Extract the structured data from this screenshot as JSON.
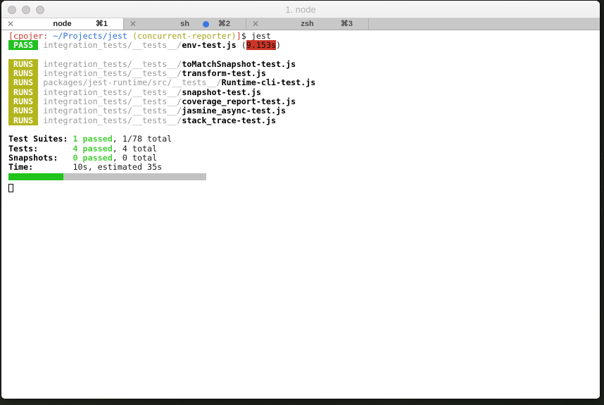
{
  "window": {
    "title": "1. node"
  },
  "colors": {
    "pass_badge": "#20c120",
    "runs_badge": "#b2b51c",
    "time_highlight": "#cc3527",
    "prompt_red": "#c5382a",
    "path_blue": "#2e6fd9",
    "branch_yellow": "#a3a31c",
    "passed_green": "#47d038",
    "progress_green": "#1ec31c",
    "tab_activity_blue": "#3b76e3"
  },
  "tabs": [
    {
      "label": "node",
      "shortcut": "⌘1",
      "close": "✕",
      "active": true,
      "activity": false
    },
    {
      "label": "sh",
      "shortcut": "⌘2",
      "close": "✕",
      "active": false,
      "activity": true
    },
    {
      "label": "zsh",
      "shortcut": "⌘3",
      "close": "✕",
      "active": false,
      "activity": false
    }
  ],
  "terminal": {
    "progress_percent": 27.8,
    "lines": [
      {
        "segments": [
          {
            "t": "[cpojer:",
            "c": "red"
          },
          {
            "t": " ",
            "c": "fg"
          },
          {
            "t": "~/Projects/jest",
            "c": "blue"
          },
          {
            "t": " ",
            "c": "fg"
          },
          {
            "t": "(concurrent-reporter)",
            "c": "yellow"
          },
          {
            "t": "]",
            "c": "red"
          },
          {
            "t": "$ jest",
            "c": "fg"
          }
        ]
      },
      {
        "segments": [
          {
            "t": " PASS ",
            "c": "badge-pass"
          },
          {
            "t": " ",
            "c": "fg"
          },
          {
            "t": "integration_tests/__tests__/",
            "c": "dim"
          },
          {
            "t": "env-test.js",
            "c": "bold"
          },
          {
            "t": " (",
            "c": "fg"
          },
          {
            "t": "9.153s",
            "c": "time-red"
          },
          {
            "t": ")",
            "c": "fg"
          }
        ]
      },
      {
        "segments": []
      },
      {
        "segments": [
          {
            "t": " RUNS ",
            "c": "badge-runs"
          },
          {
            "t": " ",
            "c": "fg"
          },
          {
            "t": "integration_tests/__tests__/",
            "c": "dim"
          },
          {
            "t": "toMatchSnapshot-test.js",
            "c": "bold"
          }
        ]
      },
      {
        "segments": [
          {
            "t": " RUNS ",
            "c": "badge-runs"
          },
          {
            "t": " ",
            "c": "fg"
          },
          {
            "t": "integration_tests/__tests__/",
            "c": "dim"
          },
          {
            "t": "transform-test.js",
            "c": "bold"
          }
        ]
      },
      {
        "segments": [
          {
            "t": " RUNS ",
            "c": "badge-runs"
          },
          {
            "t": " ",
            "c": "fg"
          },
          {
            "t": "packages/jest-runtime/src/__tests__/",
            "c": "dim"
          },
          {
            "t": "Runtime-cli-test.js",
            "c": "bold"
          }
        ]
      },
      {
        "segments": [
          {
            "t": " RUNS ",
            "c": "badge-runs"
          },
          {
            "t": " ",
            "c": "fg"
          },
          {
            "t": "integration_tests/__tests__/",
            "c": "dim"
          },
          {
            "t": "snapshot-test.js",
            "c": "bold"
          }
        ]
      },
      {
        "segments": [
          {
            "t": " RUNS ",
            "c": "badge-runs"
          },
          {
            "t": " ",
            "c": "fg"
          },
          {
            "t": "integration_tests/__tests__/",
            "c": "dim"
          },
          {
            "t": "coverage_report-test.js",
            "c": "bold"
          }
        ]
      },
      {
        "segments": [
          {
            "t": " RUNS ",
            "c": "badge-runs"
          },
          {
            "t": " ",
            "c": "fg"
          },
          {
            "t": "integration_tests/__tests__/",
            "c": "dim"
          },
          {
            "t": "jasmine_async-test.js",
            "c": "bold"
          }
        ]
      },
      {
        "segments": [
          {
            "t": " RUNS ",
            "c": "badge-runs"
          },
          {
            "t": " ",
            "c": "fg"
          },
          {
            "t": "integration_tests/__tests__/",
            "c": "dim"
          },
          {
            "t": "stack_trace-test.js",
            "c": "bold"
          }
        ]
      },
      {
        "segments": []
      },
      {
        "segments": [
          {
            "t": "Test Suites: ",
            "c": "bold"
          },
          {
            "t": "1 passed",
            "c": "green"
          },
          {
            "t": ", 1/78 total",
            "c": "fg"
          }
        ]
      },
      {
        "segments": [
          {
            "t": "Tests:       ",
            "c": "bold"
          },
          {
            "t": "4 passed",
            "c": "green"
          },
          {
            "t": ", 4 total",
            "c": "fg"
          }
        ]
      },
      {
        "segments": [
          {
            "t": "Snapshots:   ",
            "c": "bold"
          },
          {
            "t": "0 passed",
            "c": "green"
          },
          {
            "t": ", 0 total",
            "c": "fg"
          }
        ]
      },
      {
        "segments": [
          {
            "t": "Time:        ",
            "c": "bold"
          },
          {
            "t": "10s, estimated 35s",
            "c": "fg"
          }
        ]
      },
      {
        "type": "progress"
      },
      {
        "type": "cursor"
      }
    ]
  }
}
